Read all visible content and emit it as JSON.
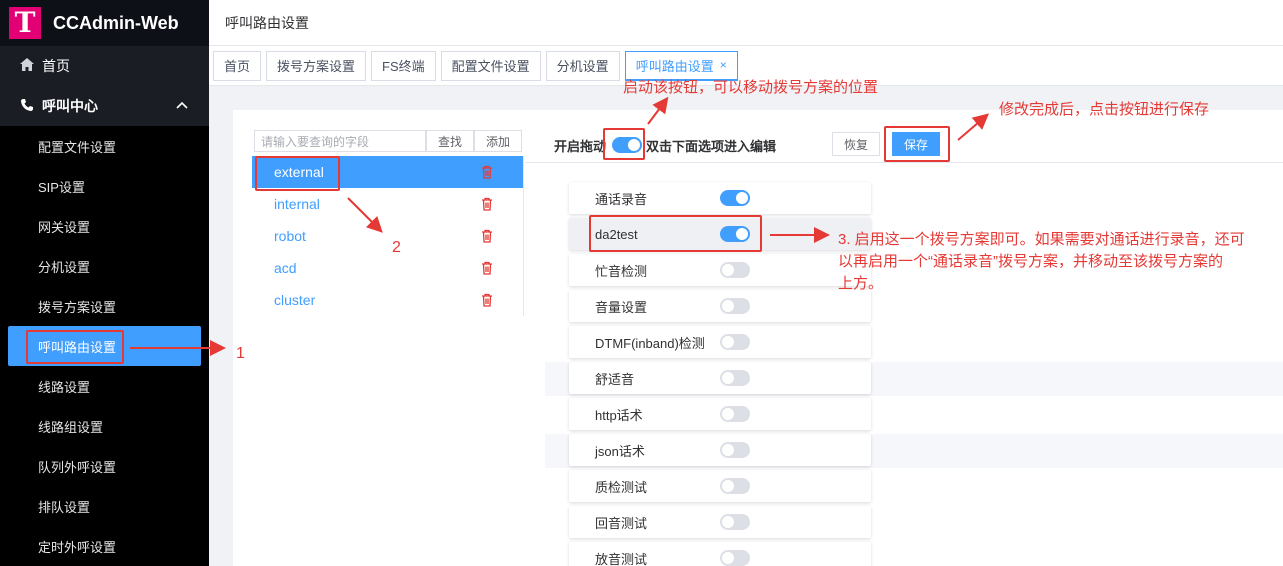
{
  "app": {
    "title": "CCAdmin-Web",
    "logo_letter": "T",
    "brand_color": "#e20074",
    "accent_color": "#409eff"
  },
  "sidebar": {
    "home_label": "首页",
    "group_label": "呼叫中心",
    "items": [
      {
        "label": "配置文件设置"
      },
      {
        "label": "SIP设置"
      },
      {
        "label": "网关设置"
      },
      {
        "label": "分机设置"
      },
      {
        "label": "拨号方案设置"
      },
      {
        "label": "呼叫路由设置",
        "active": true
      },
      {
        "label": "线路设置"
      },
      {
        "label": "线路组设置"
      },
      {
        "label": "队列外呼设置"
      },
      {
        "label": "排队设置"
      },
      {
        "label": "定时外呼设置"
      }
    ]
  },
  "header": {
    "title": "呼叫路由设置"
  },
  "tabs": [
    {
      "label": "首页"
    },
    {
      "label": "拨号方案设置"
    },
    {
      "label": "FS终端"
    },
    {
      "label": "配置文件设置"
    },
    {
      "label": "分机设置"
    },
    {
      "label": "呼叫路由设置",
      "active": true,
      "close": "×"
    }
  ],
  "left": {
    "search_placeholder": "请输入要查询的字段",
    "search_button": "查找",
    "add_button": "添加",
    "plans": [
      {
        "name": "external",
        "selected": true
      },
      {
        "name": "internal"
      },
      {
        "name": "robot"
      },
      {
        "name": "acd"
      },
      {
        "name": "cluster"
      }
    ]
  },
  "toolbar": {
    "drag_label_a": "开启拖动",
    "drag_label_b": "双击下面选项进入编辑",
    "drag_enabled": true,
    "restore_button": "恢复",
    "save_button": "保存"
  },
  "options": [
    {
      "label": "通话录音",
      "on": true
    },
    {
      "label": "da2test",
      "on": true
    },
    {
      "label": "忙音检测",
      "on": false
    },
    {
      "label": "音量设置",
      "on": false
    },
    {
      "label": "DTMF(inband)检测",
      "on": false
    },
    {
      "label": "舒适音",
      "on": false
    },
    {
      "label": "http话术",
      "on": false
    },
    {
      "label": "json话术",
      "on": false
    },
    {
      "label": "质检测试",
      "on": false
    },
    {
      "label": "回音测试",
      "on": false
    },
    {
      "label": "放音测试",
      "on": false
    }
  ],
  "annotations": {
    "note_toggle": "启动该按钮，可以移动拨号方案的位置",
    "note_save": "修改完成后，点击按钮进行保存",
    "note_step3_line1": "3. 启用这一个拨号方案即可。如果需要对通话进行录音，还可",
    "note_step3_line2": "以再启用一个“通话录音”拨号方案，并移动至该拨号方案的",
    "note_step3_line3": "上方。",
    "label_1": "1",
    "label_2": "2",
    "color": "#e53935"
  }
}
